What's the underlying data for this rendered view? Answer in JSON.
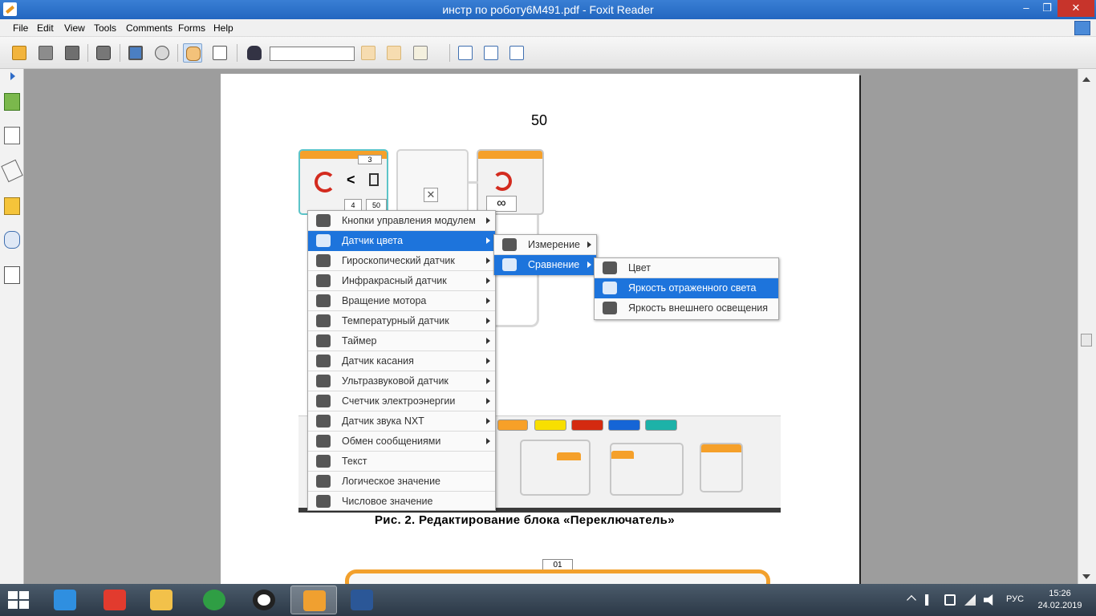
{
  "window": {
    "title": "инстр по роботу6М491.pdf - Foxit Reader",
    "minimize": "‒",
    "maximize": "❐",
    "close": "✕"
  },
  "menubar": {
    "items": [
      "File",
      "Edit",
      "View",
      "Tools",
      "Comments",
      "Forms",
      "Help"
    ]
  },
  "toolbar": {
    "search_value": "",
    "icons": [
      "open-icon",
      "save-icon",
      "save-all-icon",
      "print-icon",
      "screen-icon",
      "snapshot-icon",
      "hand-tool-icon",
      "select-text-icon",
      "find-icon",
      "prev-find-icon",
      "next-find-icon",
      "typewriter-icon",
      "actual-size-icon",
      "fit-page-icon",
      "fit-width-icon"
    ]
  },
  "document": {
    "page_number": "50",
    "caption": "Рис. 2. Редактирование блока «Переключатель»",
    "block_labels": {
      "value_top": "3",
      "compare_op": "<",
      "input_a": "4",
      "input_b": "50",
      "close": "✕",
      "loop": "∞",
      "bottom_label": "01"
    },
    "color_tabs": [
      "#f7a028",
      "#f8df00",
      "#d42a10",
      "#1565d6",
      "#1db2a8"
    ]
  },
  "menus": {
    "sensors": [
      {
        "label": "Кнопки управления модулем",
        "icon": "brick-buttons-icon",
        "submenu": true,
        "selected": false
      },
      {
        "label": "Датчик цвета",
        "icon": "color-sensor-icon",
        "submenu": true,
        "selected": true
      },
      {
        "label": "Гироскопический датчик",
        "icon": "gyro-sensor-icon",
        "submenu": true,
        "selected": false
      },
      {
        "label": "Инфракрасный датчик",
        "icon": "infrared-sensor-icon",
        "submenu": true,
        "selected": false
      },
      {
        "label": "Вращение мотора",
        "icon": "motor-rotation-icon",
        "submenu": true,
        "selected": false
      },
      {
        "label": "Температурный датчик",
        "icon": "temperature-sensor-icon",
        "submenu": true,
        "selected": false
      },
      {
        "label": "Таймер",
        "icon": "timer-icon",
        "submenu": true,
        "selected": false
      },
      {
        "label": "Датчик касания",
        "icon": "touch-sensor-icon",
        "submenu": true,
        "selected": false
      },
      {
        "label": "Ультразвуковой датчик",
        "icon": "ultrasonic-sensor-icon",
        "submenu": true,
        "selected": false
      },
      {
        "label": "Счетчик электроэнергии",
        "icon": "energy-meter-icon",
        "submenu": true,
        "selected": false
      },
      {
        "label": "Датчик звука NXT",
        "icon": "sound-sensor-icon",
        "submenu": true,
        "selected": false
      },
      {
        "label": "Обмен сообщениями",
        "icon": "bluetooth-icon",
        "submenu": true,
        "selected": false
      },
      {
        "label": "Текст",
        "icon": "text-icon",
        "submenu": false,
        "selected": false
      },
      {
        "label": "Логическое значение",
        "icon": "logic-icon",
        "submenu": false,
        "selected": false
      },
      {
        "label": "Числовое значение",
        "icon": "number-icon",
        "submenu": false,
        "selected": false
      }
    ],
    "color_sensor": [
      {
        "label": "Измерение",
        "icon": "measure-icon",
        "selected": false
      },
      {
        "label": "Сравнение",
        "icon": "compare-icon",
        "selected": true
      }
    ],
    "compare": [
      {
        "label": "Цвет",
        "icon": "color-mode-icon",
        "selected": false
      },
      {
        "label": "Яркость отраженного света",
        "icon": "reflected-light-icon",
        "selected": true
      },
      {
        "label": "Яркость внешнего освещения",
        "icon": "ambient-light-icon",
        "selected": false
      }
    ]
  },
  "taskbar": {
    "apps": [
      "internet-explorer-icon",
      "yandex-browser-icon",
      "file-explorer-icon",
      "chrome-icon",
      "opera-icon",
      "foxit-reader-icon",
      "word-icon"
    ],
    "active_app": "foxit-reader-icon",
    "lang": "РУС",
    "time": "15:26",
    "date": "24.02.2019"
  }
}
